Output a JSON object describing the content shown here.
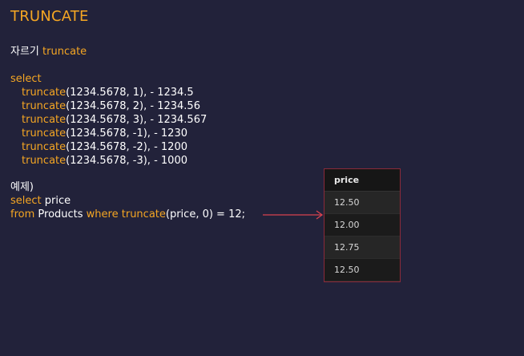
{
  "title": "TRUNCATE",
  "heading": {
    "korean": "자르기",
    "keyword": "truncate"
  },
  "select_kw": "select",
  "examples": [
    {
      "fn": "truncate",
      "args": "(1234.5678, 1), - 1234.5"
    },
    {
      "fn": "truncate",
      "args": "(1234.5678, 2), - 1234.56"
    },
    {
      "fn": "truncate",
      "args": "(1234.5678, 3), - 1234.567"
    },
    {
      "fn": "truncate",
      "args": "(1234.5678, -1), - 1230"
    },
    {
      "fn": "truncate",
      "args": "(1234.5678, -2), - 1200"
    },
    {
      "fn": "truncate",
      "args": "(1234.5678, -3), - 1000"
    }
  ],
  "example_label": "예제)",
  "query": {
    "select_kw": "select",
    "select_rest": " price",
    "from_kw": "from",
    "table": " Products ",
    "where_kw": "where",
    "space": " ",
    "fn": "truncate",
    "rest": "(price, 0) = 12;"
  },
  "result": {
    "header": "price",
    "rows": [
      "12.50",
      "12.00",
      "12.75",
      "12.50"
    ]
  },
  "colors": {
    "keyword": "#f5a623",
    "background": "#22223a",
    "arrow": "#d9434f"
  }
}
